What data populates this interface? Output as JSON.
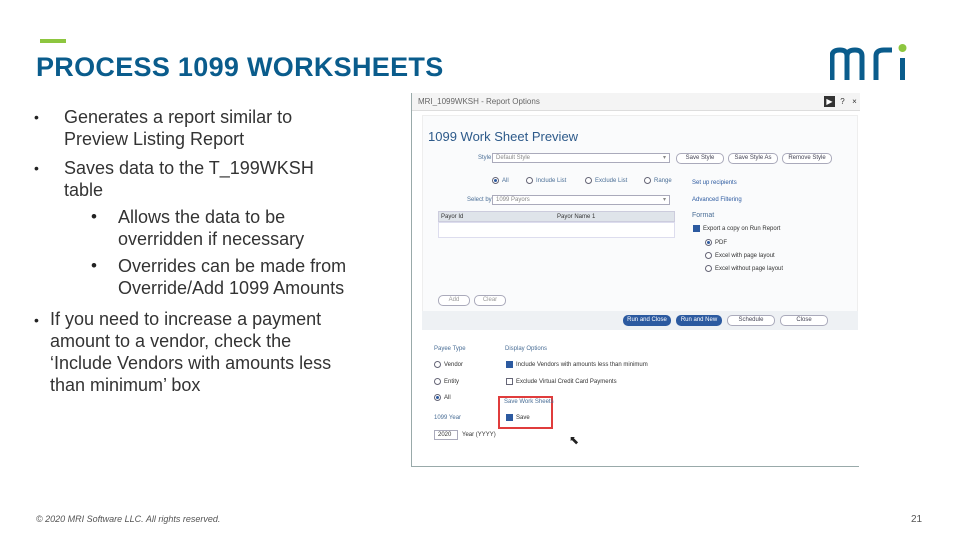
{
  "slide": {
    "title": "PROCESS 1099 WORKSHEETS",
    "footer": "© 2020 MRI Software LLC. All rights reserved.",
    "page_number": "21",
    "accent_color": "#8dc63f",
    "title_color": "#0a5c8c"
  },
  "logo": {
    "text": "mri",
    "icon": "mri-logo"
  },
  "bullets": [
    {
      "text_line1": "Generates a report similar to",
      "text_line2": "Preview Listing Report"
    },
    {
      "text_line1": "Saves data to the T_199WKSH",
      "text_line2": "table"
    },
    {
      "text_line1": "Allows the data to be",
      "text_line2": "overridden if necessary"
    },
    {
      "text_line1": "Overrides can be made from",
      "text_line2": "Override/Add 1099 Amounts"
    },
    {
      "text_line1": "If you need to increase a payment",
      "text_line2": "amount to a vendor, check  the",
      "text_line3": "‘Include Vendors with amounts less",
      "text_line4": "than minimum’ box"
    }
  ],
  "screenshot": {
    "window_title": "MRI_1099WKSH - Report Options",
    "heading": "1099 Work Sheet Preview",
    "style_label": "Style",
    "style_value": "Default Style",
    "buttons": {
      "save_style": "Save Style",
      "save_style_as": "Save Style As",
      "remove_style": "Remove Style"
    },
    "radios": {
      "all": "All",
      "include_list": "Include List",
      "exclude_list": "Exclude List",
      "range": "Range"
    },
    "select_by_label": "Select by",
    "select_by_value": "1099 Payors",
    "grid_headers": [
      "Payor Id",
      "Payor Name 1"
    ],
    "links": {
      "set_up_recipients": "Set up recipients",
      "advanced_filtering": "Advanced Filtering"
    },
    "format": {
      "label": "Format",
      "export_copy": "Export a copy on Run Report",
      "pdf": "PDF",
      "excel_page": "Excel with page layout",
      "excel_no_page": "Excel without page layout"
    },
    "add_label": "Add",
    "clear_label": "Clear",
    "action_buttons": {
      "run_close": "Run and Close",
      "run_new": "Run and New",
      "schedule": "Schedule",
      "close": "Close"
    },
    "payee_type": {
      "label": "Payee Type",
      "vendor": "Vendor",
      "entity": "Entity",
      "all": "All"
    },
    "display_options": {
      "label": "Display Options",
      "include_vendors": "Include Vendors with amounts less than minimum",
      "exclude_virtual": "Exclude Virtual Credit Card Payments"
    },
    "save_worksheets": {
      "label": "Save Work Sheets",
      "save": "Save"
    },
    "year_label": "1099 Year",
    "year_value": "2020",
    "year_format": "Year (YYYY)"
  }
}
